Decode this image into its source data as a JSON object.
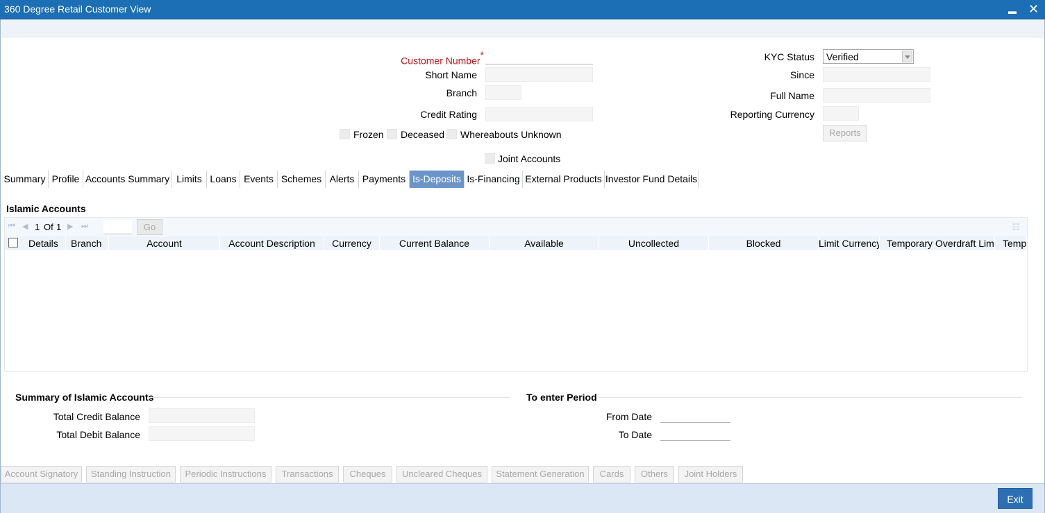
{
  "window": {
    "title": "360 Degree Retail Customer View",
    "minimize": "▬",
    "close": "✕"
  },
  "form": {
    "customer_number_label": "Customer Number",
    "required_mark": "*",
    "short_name_label": "Short Name",
    "branch_label": "Branch",
    "credit_rating_label": "Credit Rating",
    "frozen_label": "Frozen",
    "deceased_label": "Deceased",
    "whereabouts_label": "Whereabouts Unknown",
    "joint_accounts_label": "Joint Accounts",
    "kyc_status_label": "KYC Status",
    "kyc_status_value": "Verified",
    "since_label": "Since",
    "full_name_label": "Full Name",
    "reporting_currency_label": "Reporting Currency",
    "reports_button": "Reports"
  },
  "tabs": [
    "Summary",
    "Profile",
    "Accounts Summary",
    "Limits",
    "Loans",
    "Events",
    "Schemes",
    "Alerts",
    "Payments",
    "Is-Deposits",
    "Is-Financing",
    "External Products",
    "Investor Fund Details"
  ],
  "active_tab": "Is-Deposits",
  "islamic": {
    "title": "Islamic Accounts",
    "pager": {
      "current": "1",
      "of_label": "Of",
      "total": "1",
      "go": "Go"
    },
    "columns": [
      "Details",
      "Branch",
      "Account",
      "Account Description",
      "Currency",
      "Current Balance",
      "Available",
      "Uncollected",
      "Blocked",
      "Limit Currency",
      "Temporary Overdraft Limit",
      "Tempo"
    ]
  },
  "summary": {
    "title": "Summary of Islamic Accounts",
    "total_credit_label": "Total Credit Balance",
    "total_debit_label": "Total Debit Balance"
  },
  "period": {
    "title": "To enter Period",
    "from_label": "From Date",
    "to_label": "To Date"
  },
  "bottom_buttons": [
    "Account Signatory",
    "Standing Instruction",
    "Periodic Instructions",
    "Transactions",
    "Cheques",
    "Uncleared Cheques",
    "Statement Generation",
    "Cards",
    "Others",
    "Joint Holders"
  ],
  "footer": {
    "exit": "Exit"
  },
  "colors": {
    "titlebar": "#1c6fb4",
    "active_tab": "#6b95c9",
    "footer": "#dbe7f4",
    "exit_button": "#2d6fb3",
    "required": "#c0141a"
  }
}
